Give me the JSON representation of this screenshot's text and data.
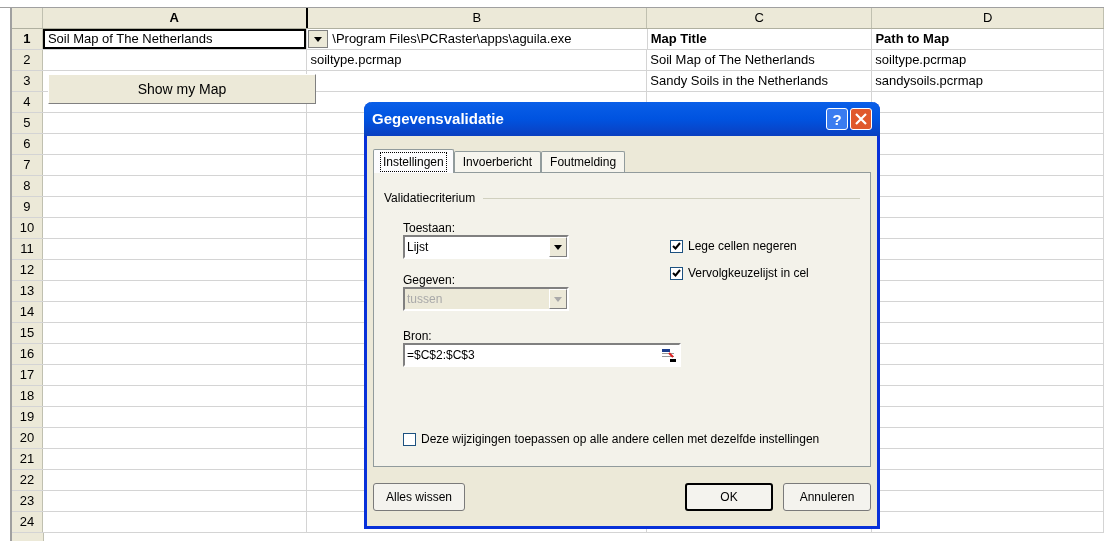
{
  "sheet": {
    "columns": [
      {
        "label": "A",
        "selected": true
      },
      {
        "label": "B",
        "selected": false
      },
      {
        "label": "C",
        "selected": false
      },
      {
        "label": "D",
        "selected": false
      }
    ],
    "rows": [
      {
        "number": "1",
        "selected": true,
        "cells": [
          {
            "text": "Soil Map of The Netherlands",
            "selected": true,
            "dropdown": true
          },
          {
            "text": "\\Program Files\\PCRaster\\apps\\aguila.exe"
          },
          {
            "text": "Map Title",
            "bold": true
          },
          {
            "text": "Path to Map",
            "bold": true
          }
        ]
      },
      {
        "number": "2",
        "selected": false,
        "cells": [
          null,
          {
            "text": "soiltype.pcrmap"
          },
          {
            "text": "Soil Map of The Netherlands"
          },
          {
            "text": "soiltype.pcrmap"
          }
        ]
      },
      {
        "number": "3",
        "selected": false,
        "cells": [
          null,
          null,
          {
            "text": "Sandy Soils in the Netherlands"
          },
          {
            "text": "sandysoils.pcrmap"
          }
        ]
      },
      {
        "number": "4",
        "selected": false
      },
      {
        "number": "5",
        "selected": false
      },
      {
        "number": "6",
        "selected": false
      },
      {
        "number": "7",
        "selected": false
      },
      {
        "number": "8",
        "selected": false
      },
      {
        "number": "9",
        "selected": false
      },
      {
        "number": "10",
        "selected": false
      },
      {
        "number": "11",
        "selected": false
      },
      {
        "number": "12",
        "selected": false
      },
      {
        "number": "13",
        "selected": false
      },
      {
        "number": "14",
        "selected": false
      },
      {
        "number": "15",
        "selected": false
      },
      {
        "number": "16",
        "selected": false
      },
      {
        "number": "17",
        "selected": false
      },
      {
        "number": "18",
        "selected": false
      },
      {
        "number": "19",
        "selected": false
      },
      {
        "number": "20",
        "selected": false
      },
      {
        "number": "21",
        "selected": false
      },
      {
        "number": "22",
        "selected": false
      },
      {
        "number": "23",
        "selected": false
      },
      {
        "number": "24",
        "selected": false
      }
    ],
    "button": {
      "label": "Show my Map"
    }
  },
  "dialog": {
    "title": "Gegevensvalidatie",
    "help_button": "?",
    "tabs": [
      {
        "label": "Instellingen",
        "selected": true
      },
      {
        "label": "Invoerbericht",
        "selected": false
      },
      {
        "label": "Foutmelding",
        "selected": false
      }
    ],
    "group_label": "Validatiecriterium",
    "allow": {
      "label": "Toestaan:",
      "value": "Lijst",
      "disabled": false
    },
    "data": {
      "label": "Gegeven:",
      "value": "tussen",
      "disabled": true
    },
    "checkboxes": [
      {
        "label": "Lege cellen negeren",
        "checked": true
      },
      {
        "label": "Vervolgkeuzelijst in cel",
        "checked": true
      }
    ],
    "source": {
      "label": "Bron:",
      "value": "=$C$2:$C$3"
    },
    "apply_all": {
      "label": "Deze wijzigingen toepassen op alle andere cellen met dezelfde instellingen",
      "checked": false
    },
    "buttons": [
      {
        "label": "Alles wissen",
        "default": false
      },
      {
        "label": "OK",
        "default": true
      },
      {
        "label": "Annuleren",
        "default": false
      }
    ]
  }
}
